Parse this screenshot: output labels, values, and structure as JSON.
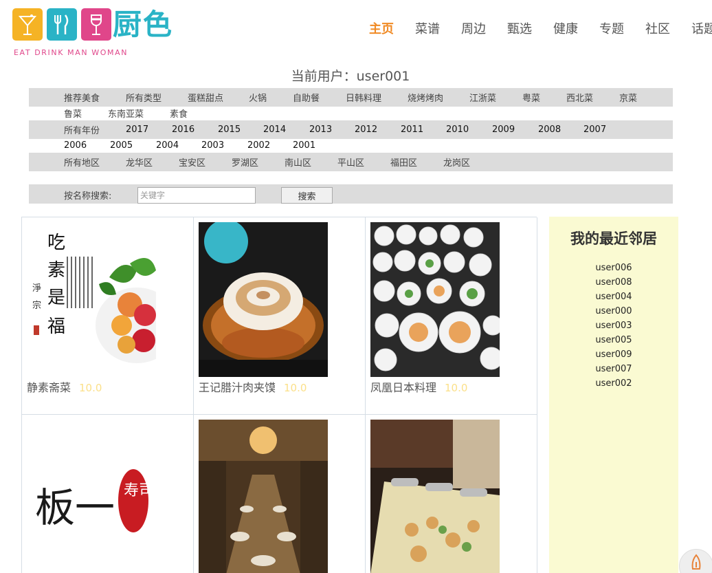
{
  "header": {
    "logo_title": "厨色",
    "logo_slogan": "EAT DRINK MAN WOMAN",
    "logo_colors": [
      "#f5b325",
      "#2ab3c6",
      "#e0468a",
      "#2ab3c6"
    ],
    "nav": [
      {
        "label": "主页",
        "active": true
      },
      {
        "label": "菜谱"
      },
      {
        "label": "周边"
      },
      {
        "label": "甄选"
      },
      {
        "label": "健康"
      },
      {
        "label": "专题"
      },
      {
        "label": "社区"
      },
      {
        "label": "话题"
      }
    ],
    "current_user": "当前用户：user001"
  },
  "filters": {
    "cuisine_row1": [
      "推荐美食",
      "所有类型",
      "蛋糕甜点",
      "火锅",
      "自助餐",
      "日韩料理",
      "烧烤烤肉",
      "江浙菜",
      "粤菜",
      "西北菜",
      "京菜"
    ],
    "cuisine_row2": [
      "鲁菜",
      "东南亚菜",
      "素食"
    ],
    "year_row1": [
      "所有年份",
      "2017",
      "2016",
      "2015",
      "2014",
      "2013",
      "2012",
      "2011",
      "2010",
      "2009",
      "2008",
      "2007"
    ],
    "year_row2": [
      "2006",
      "2005",
      "2004",
      "2003",
      "2002",
      "2001"
    ],
    "area": [
      "所有地区",
      "龙华区",
      "宝安区",
      "罗湖区",
      "南山区",
      "平山区",
      "福田区",
      "龙岗区"
    ]
  },
  "search": {
    "label": "按名称搜索:",
    "placeholder": "关键字",
    "button_label": "搜索"
  },
  "restaurants": [
    {
      "name": "静素斋菜",
      "score": "10.0",
      "image": "vegetarian-fruit-calligraphy"
    },
    {
      "name": "王记腊汁肉夹馍",
      "score": "10.0",
      "image": "roujiamo-basket"
    },
    {
      "name": "凤凰日本料理",
      "score": "10.0",
      "image": "japanese-dishes-table"
    },
    {
      "name": "",
      "score": "",
      "image": "sushi-logo-calligraphy",
      "logo_text_1": "板一",
      "logo_text_2": "寿司"
    },
    {
      "name": "",
      "score": "",
      "image": "restaurant-interior"
    },
    {
      "name": "",
      "score": "",
      "image": "buffet-table"
    }
  ],
  "neighbors": {
    "title": "我的最近邻居",
    "users": [
      "user006",
      "user008",
      "user004",
      "user000",
      "user003",
      "user005",
      "user009",
      "user007",
      "user002"
    ]
  },
  "colors": {
    "accent": "#f08a24",
    "score": "#fbe08a",
    "filter_bg": "#dcdcdc",
    "neighbor_bg": "#fafad2"
  },
  "icons": {
    "float_button": "rocket-icon"
  }
}
